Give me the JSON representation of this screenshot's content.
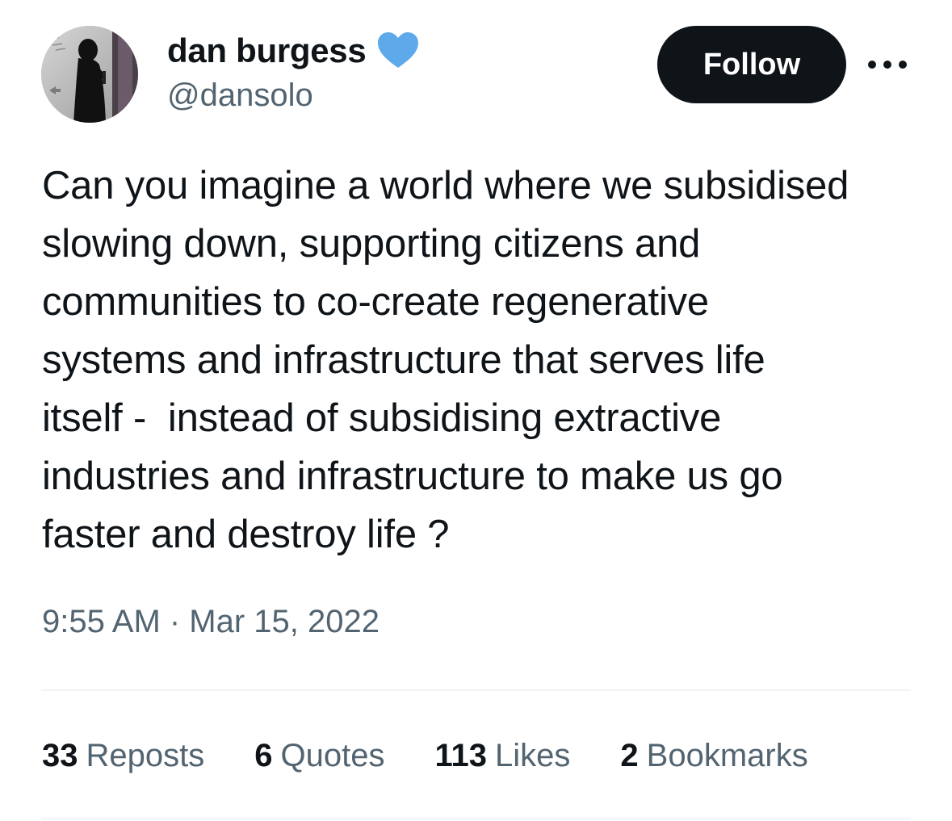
{
  "author": {
    "display_name": "dan burgess",
    "handle": "@dansolo",
    "verified_icon": "blue-heart-icon",
    "avatar": "avatar-photo"
  },
  "actions": {
    "follow_label": "Follow",
    "more_icon": "more-dots-icon"
  },
  "tweet": {
    "text": "Can you imagine a world where we subsidised\nslowing down, supporting citizens and\ncommunities to co-create regenerative\nsystems and infrastructure that serves life\nitself -  instead of subsidising extractive\nindustries and infrastructure to make us go\nfaster and destroy life ?",
    "timestamp": "9:55 AM · Mar 15, 2022"
  },
  "stats": {
    "reposts": {
      "count": "33",
      "label": "Reposts"
    },
    "quotes": {
      "count": "6",
      "label": "Quotes"
    },
    "likes": {
      "count": "113",
      "label": "Likes"
    },
    "bookmarks": {
      "count": "2",
      "label": "Bookmarks"
    }
  },
  "colors": {
    "text_primary": "#0f1419",
    "text_secondary": "#536471",
    "follow_bg": "#0f1419",
    "heart_blue": "#5da9e9",
    "divider": "#eff3f4"
  }
}
